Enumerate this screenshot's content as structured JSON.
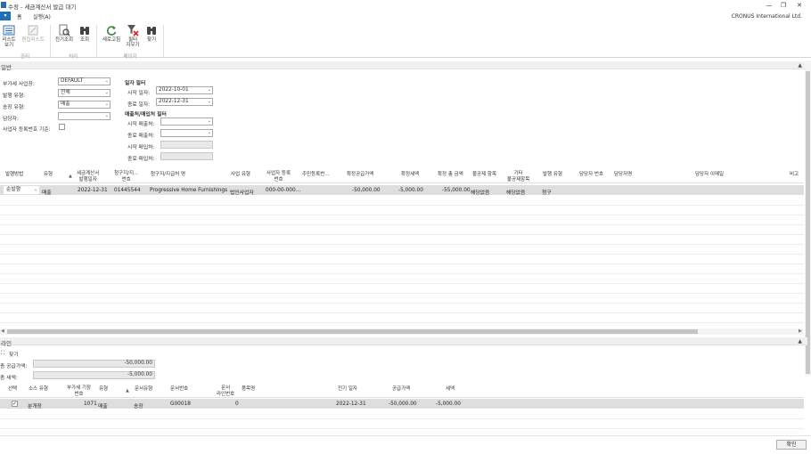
{
  "window": {
    "title": "수정 - 세금계산서 발급 대기",
    "minimize": "—",
    "restore": "❐",
    "close": "✕",
    "company": "CRONUS International Ltd."
  },
  "ribbon": {
    "file_tab": "▾",
    "tabs": [
      "홈",
      "실행(A)"
    ],
    "buttons": {
      "list_view": "리스트\n보기",
      "edit_list": "편집리스트",
      "doc_lookup": "전기조회",
      "lookup": "조회",
      "refresh": "새로고침",
      "clear_filter": "필터\n지우기",
      "find": "찾기"
    },
    "groups": [
      "관리",
      "처리",
      "페이지"
    ]
  },
  "general": {
    "header": "일반",
    "vat_business_label": "부가세 사업장:",
    "vat_business_value": "DEFAULT",
    "issue_type_label": "발행 유형:",
    "issue_type_value": "전체",
    "document_type_label": "송장 유형:",
    "document_type_value": "매출",
    "person_label": "담당자:",
    "person_value": "",
    "reg_no_basis_label": "사업자 등록번호 기준:",
    "date_filter_title": "일자 필터",
    "start_date_label": "시작 일자:",
    "start_date_value": "2022-10-01",
    "end_date_label": "종료 일자:",
    "end_date_value": "2022-12-31",
    "partner_filter_title": "매출처/매입처 필터",
    "start_customer_label": "시작 매출처:",
    "end_customer_label": "종료 매출처:",
    "start_vendor_label": "시작 매입처:",
    "end_vendor_label": "종료 매입처:"
  },
  "grid": {
    "columns": [
      "발행방법",
      "유형",
      "세금계산서\n발행일자",
      "청구지/지...\n번호",
      "청구지/지급처 명",
      "사업 유형",
      "사업자 등록\n번호",
      "주민등록번...",
      "확정공급가액",
      "확정세액",
      "확정 총 금액",
      "불공제 항목",
      "기타\n불공제항목",
      "발행 유형",
      "담당자 번호",
      "담당자명",
      "담당자 이메일",
      "비고"
    ],
    "rows": [
      {
        "method": "순발행",
        "type": "매출",
        "issue_date": "2022-12-31",
        "bill_to_no": "01445544",
        "bill_to_name": "Progressive Home Furnishings",
        "business_type": "법인사업자",
        "reg_no": "000-00-000...",
        "resident_no": "",
        "supply_amount": "-50,000.00",
        "tax_amount": "-5,000.00",
        "total_amount": "-55,000.00",
        "non_deductible": "해당없음",
        "other_non_deductible": "해당없음",
        "issue_type": "청구"
      }
    ]
  },
  "lines": {
    "header": "라인",
    "find_label": "찾기",
    "total_supply_label": "총 공급가액:",
    "total_supply_value": "-50,000.00",
    "total_tax_label": "총 세액:",
    "total_tax_value": "-5,000.00",
    "columns": [
      "선택",
      "소스 유형",
      "부가세 기장\n번호",
      "유형",
      "문서유형",
      "문서번호",
      "문서\n라인번호",
      "품목명",
      "전기 일자",
      "공급가액",
      "세액"
    ],
    "rows": [
      {
        "selected": "✓",
        "source_type": "분개장",
        "vat_entry_no": "1071",
        "type": "매출",
        "doc_type": "송장",
        "doc_no": "G00018",
        "line_no": "0",
        "item_name": "",
        "posting_date": "2022-12-31",
        "supply": "-50,000.00",
        "tax": "-5,000.00"
      }
    ]
  },
  "footer": {
    "confirm": "확인"
  }
}
